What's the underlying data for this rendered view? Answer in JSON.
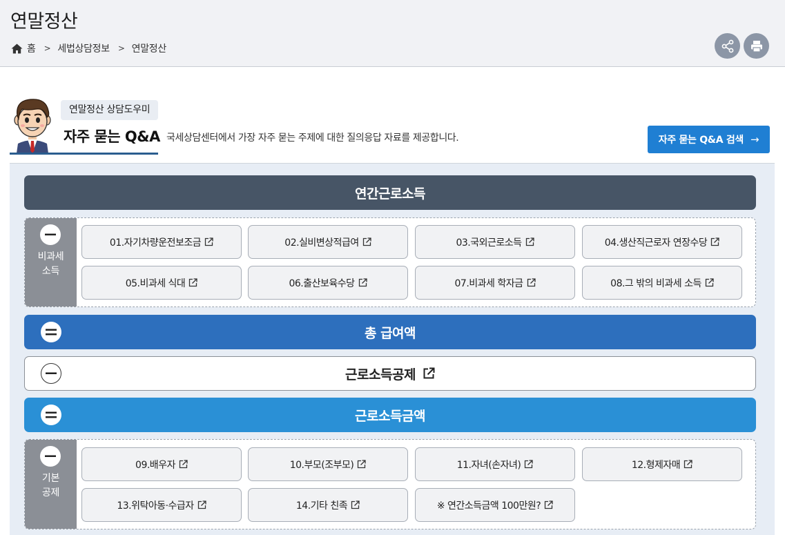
{
  "header": {
    "title": "연말정산",
    "breadcrumb": [
      "홈",
      "세법상담정보",
      "연말정산"
    ]
  },
  "qa": {
    "tag": "연말정산 상담도우미",
    "title": "자주 묻는 Q&A",
    "description": "국세상담센터에서 가장 자주 묻는 주제에 대한 질의응답 자료를 제공합니다.",
    "search_button": "자주 묻는 Q&A 검색",
    "search_arrow": "→"
  },
  "sections": {
    "annual_income": "연간근로소득",
    "nontaxable_label": [
      "비과세",
      "소득"
    ],
    "nontaxable_items": [
      "01.자기차량운전보조금",
      "02.실비변상적급여",
      "03.국외근로소득",
      "04.생산직근로자 연장수당",
      "05.비과세 식대",
      "06.출산보육수당",
      "07.비과세 학자금",
      "08.그 밖의 비과세 소득"
    ],
    "total_pay": "총 급여액",
    "earned_deduction": "근로소득공제",
    "earned_amount": "근로소득금액",
    "basic_label": [
      "기본",
      "공제"
    ],
    "basic_items": [
      "09.배우자",
      "10.부모(조부모)",
      "11.자녀(손자녀)",
      "12.형제자매",
      "13.위탁아동·수급자",
      "14.기타 친족",
      "※ 연간소득금액 100만원?"
    ]
  },
  "colors": {
    "dark_bar": "#475566",
    "blue_bar": "#2d6fbd",
    "sky_bar": "#2a90d6",
    "accent_button": "#1f7fd3"
  },
  "icons": [
    "home-icon",
    "share-icon",
    "print-icon",
    "external-link-icon",
    "minus-icon",
    "equals-icon"
  ]
}
